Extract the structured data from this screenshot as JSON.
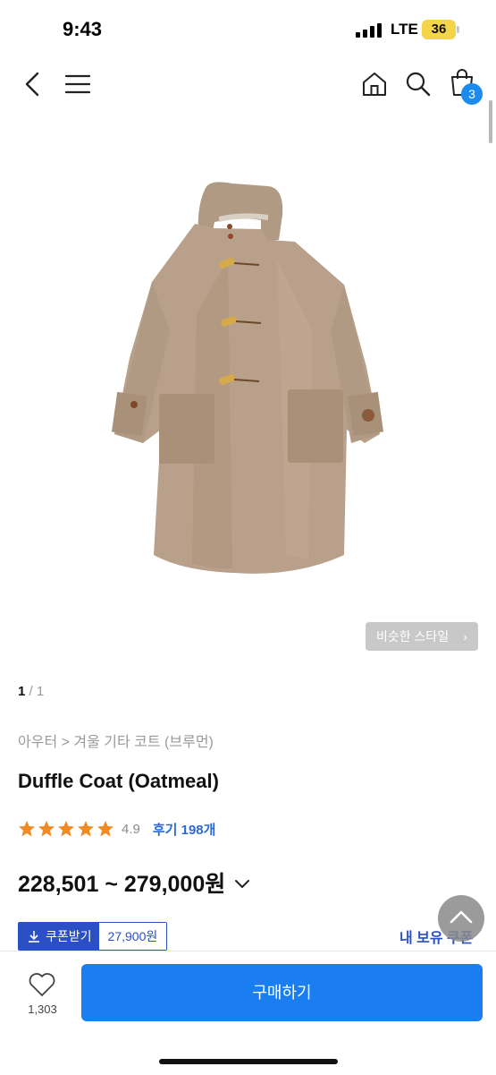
{
  "status_bar": {
    "time": "9:43",
    "network": "LTE",
    "battery": "36"
  },
  "nav": {
    "cart_count": "3"
  },
  "product": {
    "similar_style_label": "비슷한 스타일",
    "image_page_current": "1",
    "image_page_rest": " / 1",
    "breadcrumb": "아우터 > 겨울 기타 코트 (브루먼)",
    "title": "Duffle Coat (Oatmeal)",
    "rating": "4.9",
    "rating_stars": 5,
    "reviews_label": "후기 198개",
    "price_range": "228,501 ~ 279,000원",
    "coupon_label": "쿠폰받기",
    "coupon_value": "27,900원",
    "my_coupons_label": "내 보유 쿠폰"
  },
  "bottom_bar": {
    "like_count": "1,303",
    "buy_label": "구매하기"
  },
  "colors": {
    "accent": "#1a7df0",
    "coupon": "#2b4fc4",
    "star": "#f08a24",
    "coat": "#b8a08a"
  },
  "icons": [
    "back-icon",
    "menu-icon",
    "home-icon",
    "search-icon",
    "cart-icon",
    "heart-icon",
    "chevron-up-icon",
    "download-icon",
    "chevron-down-icon",
    "star-icon"
  ]
}
